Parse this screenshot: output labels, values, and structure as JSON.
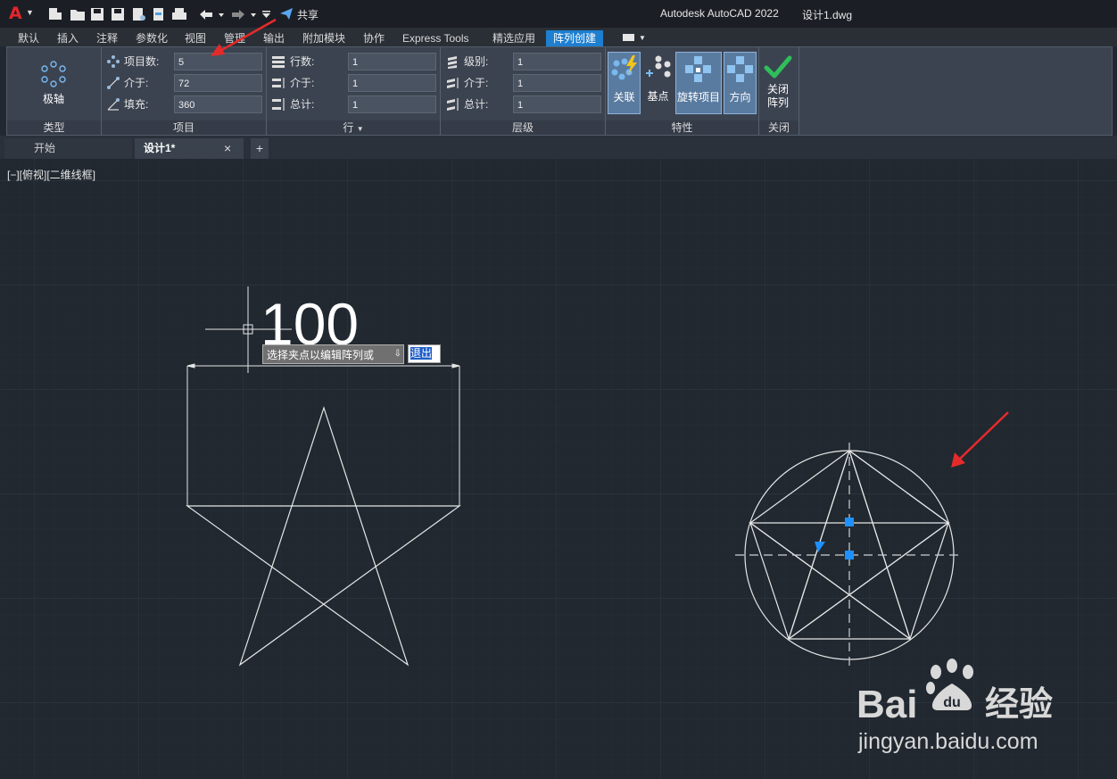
{
  "titlebar": {
    "app_logo": "A",
    "share_label": "共享",
    "title": "Autodesk AutoCAD 2022",
    "filename": "设计1.dwg"
  },
  "ribbon_tabs": [
    "默认",
    "插入",
    "注释",
    "参数化",
    "视图",
    "管理",
    "输出",
    "附加模块",
    "协作",
    "Express Tools",
    "精选应用",
    "阵列创建"
  ],
  "ribbon": {
    "type_panel": {
      "button": "极轴",
      "title": "类型"
    },
    "items_panel": {
      "title": "项目",
      "fields": [
        {
          "label": "项目数:",
          "value": "5"
        },
        {
          "label": "介于:",
          "value": "72"
        },
        {
          "label": "填充:",
          "value": "360"
        }
      ]
    },
    "rows_panel": {
      "title": "行",
      "fields": [
        {
          "label": "行数:",
          "value": "1"
        },
        {
          "label": "介于:",
          "value": "1"
        },
        {
          "label": "总计:",
          "value": "1"
        }
      ]
    },
    "levels_panel": {
      "title": "层级",
      "fields": [
        {
          "label": "级别:",
          "value": "1"
        },
        {
          "label": "介于:",
          "value": "1"
        },
        {
          "label": "总计:",
          "value": "1"
        }
      ]
    },
    "properties_panel": {
      "title": "特性",
      "buttons": [
        "关联",
        "基点",
        "旋转项目",
        "方向"
      ]
    },
    "close_panel": {
      "title": "关闭",
      "button_line1": "关闭",
      "button_line2": "阵列"
    }
  },
  "doc_tabs": {
    "start": "开始",
    "current": "设计1*",
    "close": "×",
    "add": "+"
  },
  "viewport": {
    "label": "[−][俯视][二维线框]",
    "dimension_text": "100",
    "prompt_text": "选择夹点以编辑阵列或",
    "prompt_input": "退出"
  },
  "watermark": {
    "brand": "Bai",
    "brand2": "经验",
    "url": "jingyan.baidu.com"
  },
  "colors": {
    "accent": "#1e7fd0",
    "grip": "#1e90ff",
    "arrow": "#e52a2a",
    "check": "#2fbf5a"
  }
}
